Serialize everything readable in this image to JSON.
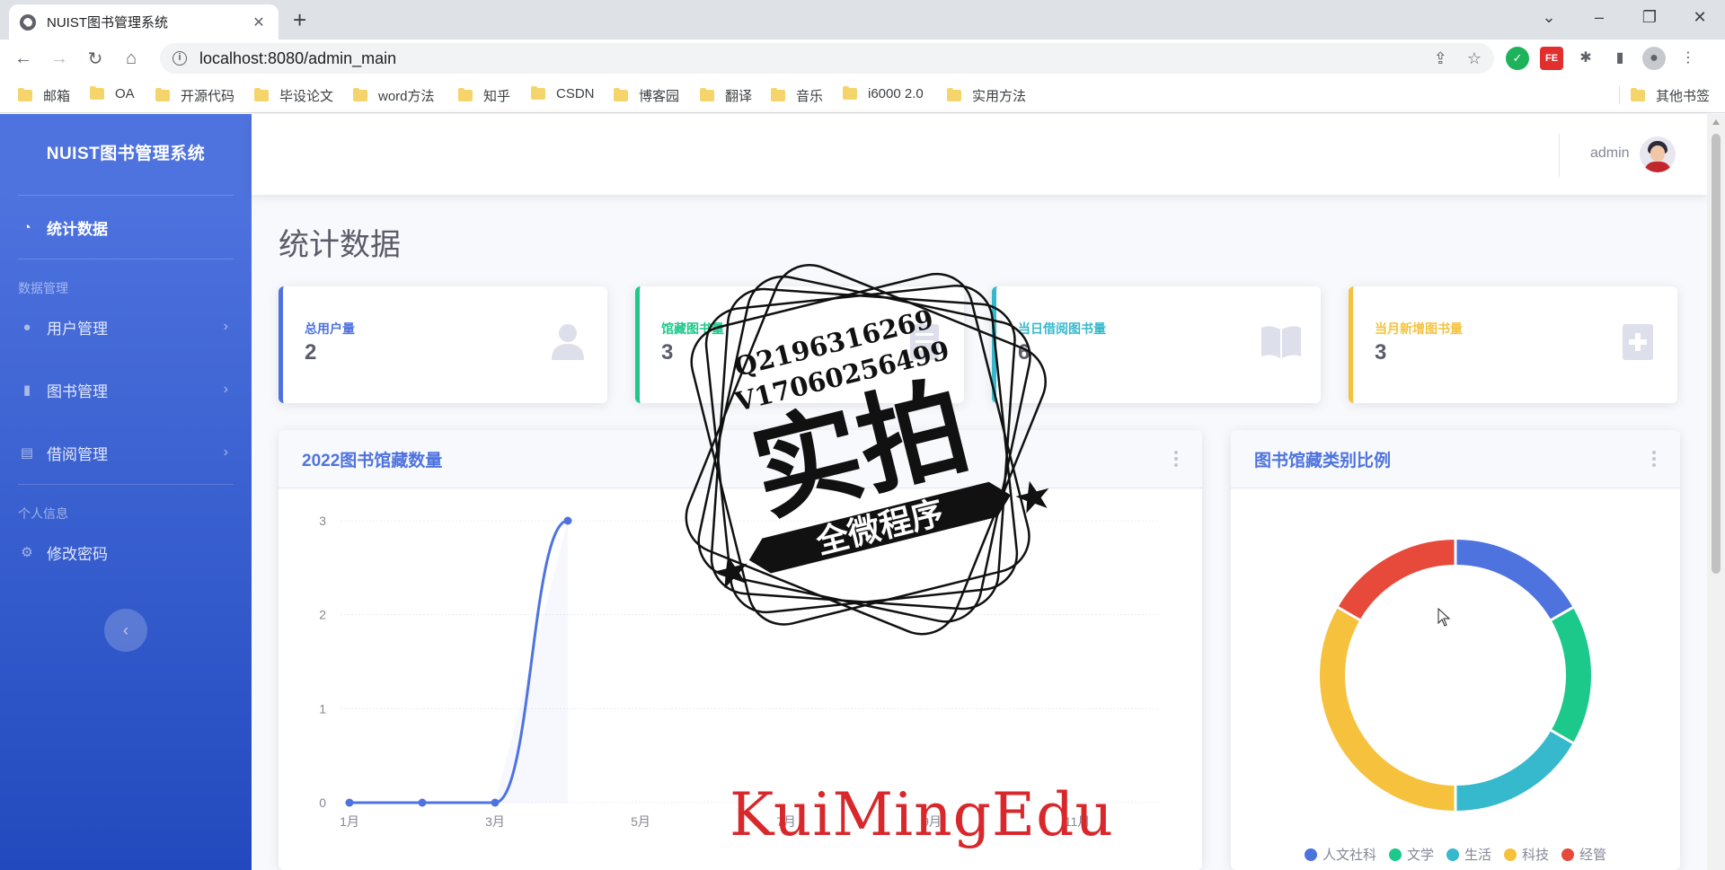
{
  "browser": {
    "tab_title": "NUIST图书管理系统",
    "url": "localhost:8080/admin_main",
    "bookmarks": [
      "邮箱",
      "OA",
      "开源代码",
      "毕设论文",
      "word方法",
      "知乎",
      "CSDN",
      "博客园",
      "翻译",
      "音乐",
      "i6000 2.0",
      "实用方法"
    ],
    "other_bookmarks": "其他书签"
  },
  "sidebar": {
    "brand": "NUIST图书管理系统",
    "dashboard": "统计数据",
    "section_data": "数据管理",
    "user_mgmt": "用户管理",
    "book_mgmt": "图书管理",
    "borrow_mgmt": "借阅管理",
    "section_personal": "个人信息",
    "change_password": "修改密码"
  },
  "topbar": {
    "username": "admin"
  },
  "page": {
    "title": "统计数据"
  },
  "stats": [
    {
      "label": "总用户量",
      "value": "2",
      "color": "#4e73df",
      "icon": "user-icon"
    },
    {
      "label": "馆藏图书量",
      "value": "3",
      "color": "#1cc88a",
      "icon": "book-list-icon"
    },
    {
      "label": "当日借阅图书量",
      "value": "6",
      "color": "#36b9cc",
      "icon": "open-book-icon"
    },
    {
      "label": "当月新增图书量",
      "value": "3",
      "color": "#f6c23e",
      "icon": "book-plus-icon"
    }
  ],
  "line_panel": {
    "title": "2022图书馆藏数量"
  },
  "pie_panel": {
    "title": "图书馆藏类别比例"
  },
  "chart_data": [
    {
      "type": "line",
      "title": "2022图书馆藏数量",
      "x": [
        "1月",
        "2月",
        "3月",
        "4月"
      ],
      "y": [
        0,
        0,
        0,
        3
      ],
      "x_ticks": [
        "1月",
        "3月",
        "5月",
        "7月",
        "9月",
        "11月"
      ],
      "y_ticks": [
        0,
        1,
        2,
        3
      ],
      "ylim": [
        0,
        3
      ],
      "color": "#4e73df",
      "grid": true
    },
    {
      "type": "pie",
      "variant": "doughnut",
      "title": "图书馆藏类别比例",
      "labels": [
        "人文社科",
        "文学",
        "生活",
        "科技",
        "经管"
      ],
      "values": [
        1,
        1,
        1,
        2,
        1
      ],
      "colors": [
        "#4e73df",
        "#1cc88a",
        "#36b9cc",
        "#f6c23e",
        "#e74a3b"
      ],
      "legend": "bottom"
    }
  ],
  "overlay": {
    "stamp_line1": "Q2196316269",
    "stamp_line2": "V17060256499",
    "stamp_main": "实拍",
    "stamp_banner": "全微程序",
    "watermark": "KuiMingEdu"
  }
}
